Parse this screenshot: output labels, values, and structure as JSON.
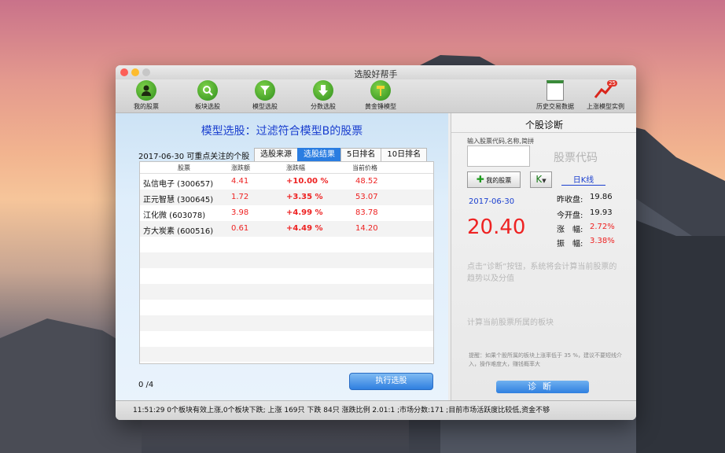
{
  "window": {
    "title": "选股好帮手"
  },
  "toolbar": [
    {
      "label": "我的股票",
      "icon": "person-icon"
    },
    {
      "label": "板块选股",
      "icon": "magnifier-icon"
    },
    {
      "label": "模型选股",
      "icon": "funnel-icon"
    },
    {
      "label": "分数选股",
      "icon": "down-arrow-icon"
    },
    {
      "label": "黄金锤模型",
      "icon": "hammer-icon"
    }
  ],
  "toolbar_right": [
    {
      "label": "历史交易数据",
      "icon": "notepad-icon"
    },
    {
      "label": "上涨模型实例",
      "icon": "rising-chart-icon",
      "badge": "25"
    }
  ],
  "main": {
    "heading": "模型选股：过滤符合模型B的股票",
    "info": "2017-06-30 可重点关注的个股",
    "tabs": [
      "选股来源",
      "选股结果",
      "5日排名",
      "10日排名"
    ],
    "active_tab": "选股结果",
    "columns": [
      "股票",
      "涨跌额",
      "涨跌幅",
      "当前价格"
    ],
    "rows": [
      {
        "name": "弘信电子 (300657)",
        "change": "4.41",
        "pct": "+10.00 %",
        "price": "48.52"
      },
      {
        "name": "正元智慧 (300645)",
        "change": "1.72",
        "pct": "+3.35 %",
        "price": "53.07"
      },
      {
        "name": "江化微 (603078)",
        "change": "3.98",
        "pct": "+4.99 %",
        "price": "83.78"
      },
      {
        "name": "方大炭素 (600516)",
        "change": "0.61",
        "pct": "+4.49 %",
        "price": "14.20"
      }
    ],
    "count": "0 /4",
    "run_button": "执行选股"
  },
  "diagnosis": {
    "title": "个股诊断",
    "input_hint": "输入股票代码,名称,简拼",
    "input_placeholder": "股票代码",
    "my_stocks_button": "我的股票",
    "k_button": "K",
    "kline_link": "日K线",
    "date": "2017-06-30",
    "price": "20.40",
    "prev_close_label": "昨收盘:",
    "prev_close": "19.86",
    "open_label": "今开盘:",
    "open": "19.93",
    "change_label": "涨　幅:",
    "change": "2.72%",
    "amplitude_label": "振　幅:",
    "amplitude": "3.38%",
    "desc1": "点击“诊断”按钮，系统将会计算当前股票的趋势以及分值",
    "desc2": "计算当前股票所属的板块",
    "warning": "提醒：如果个股所属的板块上涨率低于 35 %，建议不要短线介入，操作难度大，赚钱概率大",
    "diag_button": "诊断"
  },
  "statusbar": {
    "text": "11:51:29  0个板块有效上涨,0个板块下跌; 上涨 169只 下跌 84只 涨跌比例 2.01:1 ;市场分数:171 ;目前市场活跃度比较低,资金不够"
  },
  "colors": {
    "accent": "#2a7de1",
    "red": "#e22",
    "heading": "#1a3fcf"
  }
}
